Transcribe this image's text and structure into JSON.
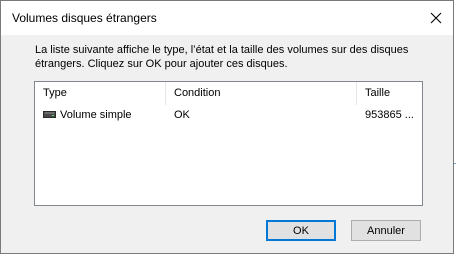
{
  "dialog": {
    "title": "Volumes disques étrangers",
    "close_icon": "close-icon",
    "description_line1": "La liste suivante affiche le type, l’état et la taille des volumes sur des disques",
    "description_line2": "étrangers. Cliquez sur OK pour ajouter ces disques."
  },
  "listview": {
    "columns": [
      {
        "label": "Type"
      },
      {
        "label": "Condition"
      },
      {
        "label": "Taille"
      }
    ],
    "rows": [
      {
        "type": "Volume simple",
        "condition": "OK",
        "taille": "953865 ...",
        "icon": "disk-icon"
      }
    ]
  },
  "buttons": {
    "ok": "OK",
    "cancel": "Annuler"
  },
  "colors": {
    "accent": "#0078d7",
    "dialog_bg": "#f0f0f0",
    "titlebar_bg": "#ffffff"
  }
}
